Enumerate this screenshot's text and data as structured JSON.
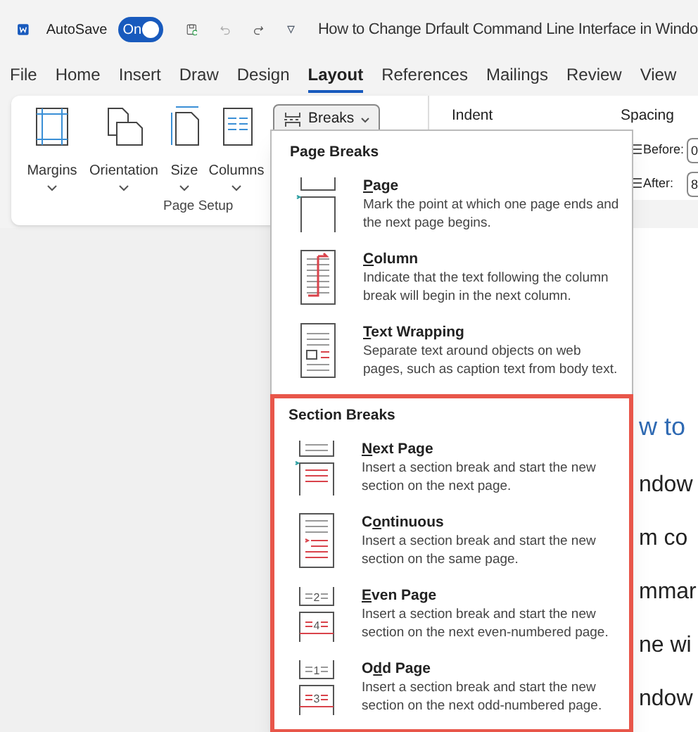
{
  "title_bar": {
    "autosave_label": "AutoSave",
    "autosave": {
      "label": "On",
      "on": true
    },
    "customize_glyph": "▿",
    "document_title": "How to Change Drfault Command Line Interface in Windo"
  },
  "tabs": [
    {
      "label": "File",
      "selected": false
    },
    {
      "label": "Home",
      "selected": false
    },
    {
      "label": "Insert",
      "selected": false
    },
    {
      "label": "Draw",
      "selected": false
    },
    {
      "label": "Design",
      "selected": false
    },
    {
      "label": "Layout",
      "selected": true
    },
    {
      "label": "References",
      "selected": false
    },
    {
      "label": "Mailings",
      "selected": false
    },
    {
      "label": "Review",
      "selected": false
    },
    {
      "label": "View",
      "selected": false
    }
  ],
  "ribbon": {
    "page_setup": {
      "buttons": [
        {
          "kind": "margins",
          "label": "Margins"
        },
        {
          "kind": "orientation",
          "label": "Orientation"
        },
        {
          "kind": "size",
          "label": "Size"
        },
        {
          "kind": "columns",
          "label": "Columns"
        }
      ],
      "breaks": {
        "label": "Breaks",
        "expanded": true
      },
      "group_label": "Page Setup"
    },
    "paragraph": {
      "indent_label": "Indent",
      "spacing_label": "Spacing",
      "before": {
        "label": "Before:",
        "value": "0"
      },
      "after": {
        "label": "After:",
        "value": "8"
      }
    }
  },
  "breaks_menu": {
    "sections": [
      {
        "heading": "Page Breaks",
        "highlighted": false,
        "items": [
          {
            "kind": "page",
            "label": {
              "key": "P",
              "after": "age"
            },
            "description": "Mark the point at which one page ends and the next page begins."
          },
          {
            "kind": "column",
            "label": {
              "key": "C",
              "after": "olumn"
            },
            "description": "Indicate that the text following the column break will begin in the next column."
          },
          {
            "kind": "text_wrapping",
            "label": {
              "key": "T",
              "after": "ext Wrapping"
            },
            "description": "Separate text around objects on web pages, such as caption text from body text."
          }
        ]
      },
      {
        "heading": "Section Breaks",
        "highlighted": true,
        "items": [
          {
            "kind": "next_page",
            "label": {
              "key": "N",
              "after": "ext Page"
            },
            "description": "Insert a section break and start the new section on the next page."
          },
          {
            "kind": "continuous",
            "label": {
              "before": "C",
              "key": "o",
              "after": "ntinuous"
            },
            "description": "Insert a section break and start the new section on the same page."
          },
          {
            "kind": "even_page",
            "label": {
              "key": "E",
              "after": "ven Page"
            },
            "icon_digits": [
              "2",
              "4"
            ],
            "description": "Insert a section break and start the new section on the next even-numbered page."
          },
          {
            "kind": "odd_page",
            "label": {
              "before": "O",
              "key": "d",
              "after": "d Page"
            },
            "icon_digits": [
              "1",
              "3"
            ],
            "description": "Insert a section break and start the new section on the next odd-numbered page."
          }
        ]
      }
    ]
  },
  "document": {
    "lines": [
      {
        "kind": "heading",
        "text": "w to"
      },
      {
        "kind": "body",
        "text": "ndow"
      },
      {
        "kind": "body",
        "text": "m co"
      },
      {
        "kind": "body",
        "text": "mmar"
      },
      {
        "kind": "body",
        "text": "ne wi"
      },
      {
        "kind": "body",
        "text": "ndow"
      }
    ]
  }
}
